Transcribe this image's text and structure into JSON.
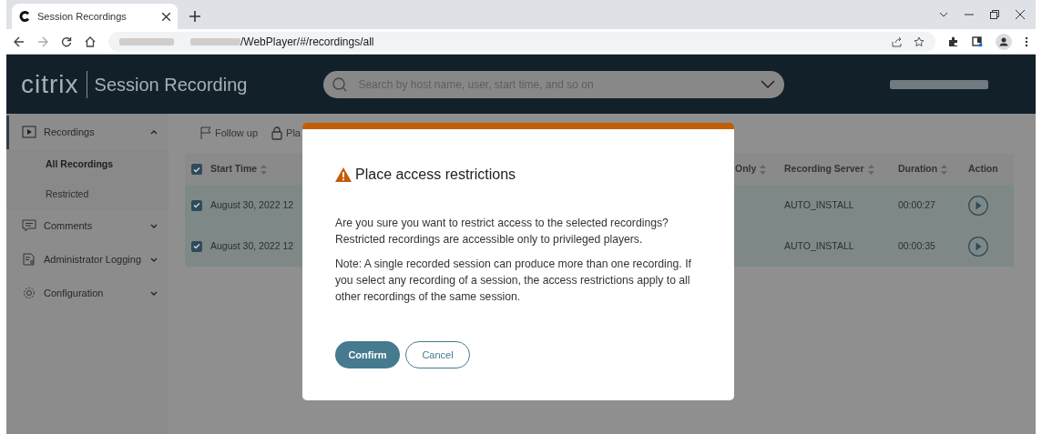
{
  "browser": {
    "tab": {
      "title": "Session Recordings",
      "selected": true
    },
    "url": "/WebPlayer/#/recordings/all"
  },
  "header": {
    "logo": "citrix",
    "product": "Session Recording",
    "search": {
      "placeholder": "Search by host name, user, start time, and so on"
    }
  },
  "sidebar": {
    "items": [
      {
        "label": "Recordings",
        "expanded": true,
        "children": [
          {
            "label": "All Recordings",
            "selected": true
          },
          {
            "label": "Restricted",
            "selected": false
          }
        ]
      },
      {
        "label": "Comments",
        "expanded": false
      },
      {
        "label": "Administrator Logging",
        "expanded": false
      },
      {
        "label": "Configuration",
        "expanded": false
      }
    ]
  },
  "toolbar": [
    {
      "label": "Follow up"
    },
    {
      "label": "Pla"
    }
  ],
  "table": {
    "select_all": {
      "checked": true
    },
    "columns": [
      {
        "label": "Start Time",
        "sortable": true
      },
      {
        "label": "Only",
        "sortable": true
      },
      {
        "label": "Recording Server",
        "sortable": true
      },
      {
        "label": "Duration",
        "sortable": true
      },
      {
        "label": "Action",
        "sortable": false
      }
    ],
    "rows": [
      {
        "checked": true,
        "selected": true,
        "start_time": "August 30, 2022 12",
        "server": "AUTO_INSTALL",
        "duration": "00:00:27"
      },
      {
        "checked": true,
        "selected": true,
        "start_time": "August 30, 2022 12",
        "server": "AUTO_INSTALL",
        "duration": "00:00:35"
      }
    ]
  },
  "dialog": {
    "title": "Place access restrictions",
    "paragraphs": [
      "Are you sure you want to restrict access to the selected recordings? Restricted recordings are accessible only to privileged players.",
      "Note: A single recorded session can produce more than one recording. If you select any recording of a session, the access restrictions apply to all other recordings of the same session."
    ],
    "buttons": [
      {
        "label": "Confirm",
        "kind": "primary"
      },
      {
        "label": "Cancel",
        "kind": "outline"
      }
    ]
  }
}
